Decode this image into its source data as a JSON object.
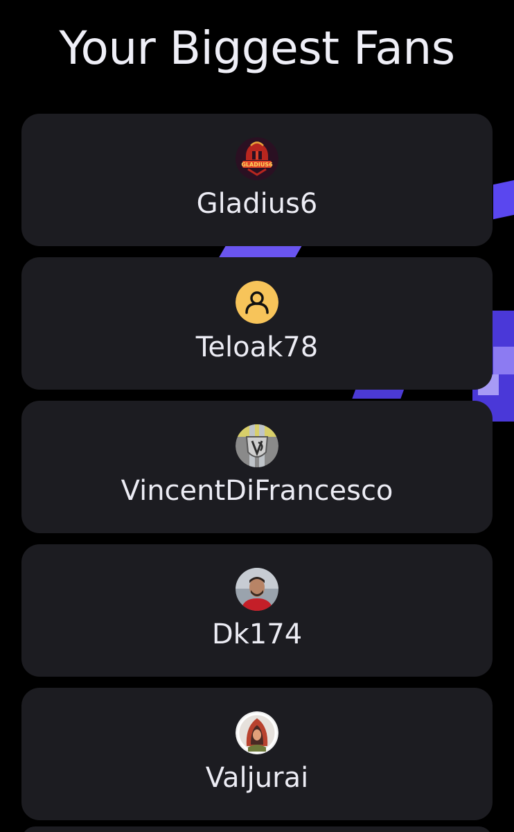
{
  "header": {
    "title": "Your Biggest Fans"
  },
  "fans": [
    {
      "name": "Gladius6",
      "avatar": "gladius-shield-logo-avatar",
      "avatar_text": "GLADIUS6"
    },
    {
      "name": "Teloak78",
      "avatar": "default-user-icon",
      "avatar_bg": "#f7c45a"
    },
    {
      "name": "VincentDiFrancesco",
      "avatar": "vd-monogram-avatar"
    },
    {
      "name": "Dk174",
      "avatar": "profile-photo-avatar"
    },
    {
      "name": "Valjurai",
      "avatar": "hooded-character-avatar"
    }
  ],
  "colors": {
    "background": "#000000",
    "card": "#1c1c21",
    "text": "#ececf4",
    "accent": "#5b4ae6"
  }
}
